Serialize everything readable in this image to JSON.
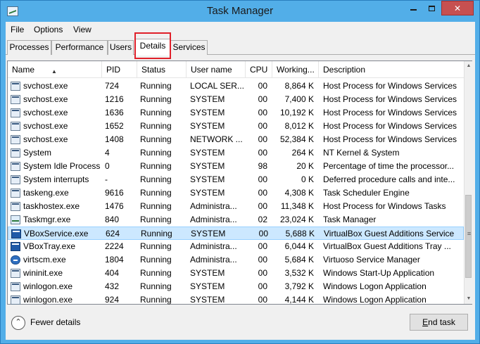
{
  "window": {
    "title": "Task Manager",
    "minimize": "",
    "maximize": "",
    "close": "✕"
  },
  "menu": [
    "File",
    "Options",
    "View"
  ],
  "tabs": [
    {
      "label": "Processes"
    },
    {
      "label": "Performance"
    },
    {
      "label": "Users"
    },
    {
      "label": "Details",
      "active": true
    },
    {
      "label": "Services"
    }
  ],
  "columns": {
    "name": "Name",
    "pid": "PID",
    "status": "Status",
    "user": "User name",
    "cpu": "CPU",
    "working": "Working...",
    "description": "Description"
  },
  "rows": [
    {
      "icon": "service-icon",
      "name": "svchost.exe",
      "pid": "724",
      "status": "Running",
      "user": "LOCAL SER...",
      "cpu": "00",
      "ws": "8,864 K",
      "desc": "Host Process for Windows Services"
    },
    {
      "icon": "service-icon",
      "name": "svchost.exe",
      "pid": "1216",
      "status": "Running",
      "user": "SYSTEM",
      "cpu": "00",
      "ws": "7,400 K",
      "desc": "Host Process for Windows Services"
    },
    {
      "icon": "service-icon",
      "name": "svchost.exe",
      "pid": "1636",
      "status": "Running",
      "user": "SYSTEM",
      "cpu": "00",
      "ws": "10,192 K",
      "desc": "Host Process for Windows Services"
    },
    {
      "icon": "service-icon",
      "name": "svchost.exe",
      "pid": "1652",
      "status": "Running",
      "user": "SYSTEM",
      "cpu": "00",
      "ws": "8,012 K",
      "desc": "Host Process for Windows Services"
    },
    {
      "icon": "service-icon",
      "name": "svchost.exe",
      "pid": "1408",
      "status": "Running",
      "user": "NETWORK ...",
      "cpu": "00",
      "ws": "52,384 K",
      "desc": "Host Process for Windows Services"
    },
    {
      "icon": "service-icon",
      "name": "System",
      "pid": "4",
      "status": "Running",
      "user": "SYSTEM",
      "cpu": "00",
      "ws": "264 K",
      "desc": "NT Kernel & System"
    },
    {
      "icon": "service-icon",
      "name": "System Idle Process",
      "pid": "0",
      "status": "Running",
      "user": "SYSTEM",
      "cpu": "98",
      "ws": "20 K",
      "desc": "Percentage of time the processor..."
    },
    {
      "icon": "service-icon",
      "name": "System interrupts",
      "pid": "-",
      "status": "Running",
      "user": "SYSTEM",
      "cpu": "00",
      "ws": "0 K",
      "desc": "Deferred procedure calls and inte..."
    },
    {
      "icon": "service-icon",
      "name": "taskeng.exe",
      "pid": "9616",
      "status": "Running",
      "user": "SYSTEM",
      "cpu": "00",
      "ws": "4,308 K",
      "desc": "Task Scheduler Engine"
    },
    {
      "icon": "service-icon",
      "name": "taskhostex.exe",
      "pid": "1476",
      "status": "Running",
      "user": "Administra...",
      "cpu": "00",
      "ws": "11,348 K",
      "desc": "Host Process for Windows Tasks"
    },
    {
      "icon": "task-manager-icon",
      "name": "Taskmgr.exe",
      "pid": "840",
      "status": "Running",
      "user": "Administra...",
      "cpu": "02",
      "ws": "23,024 K",
      "desc": "Task Manager"
    },
    {
      "icon": "virtualbox-icon",
      "name": "VBoxService.exe",
      "pid": "624",
      "status": "Running",
      "user": "SYSTEM",
      "cpu": "00",
      "ws": "5,688 K",
      "desc": "VirtualBox Guest Additions Service",
      "selected": true
    },
    {
      "icon": "virtualbox-icon",
      "name": "VBoxTray.exe",
      "pid": "2224",
      "status": "Running",
      "user": "Administra...",
      "cpu": "00",
      "ws": "6,044 K",
      "desc": "VirtualBox Guest Additions Tray ..."
    },
    {
      "icon": "virtuoso-icon",
      "name": "virtscm.exe",
      "pid": "1804",
      "status": "Running",
      "user": "Administra...",
      "cpu": "00",
      "ws": "5,684 K",
      "desc": "Virtuoso Service Manager"
    },
    {
      "icon": "service-icon",
      "name": "wininit.exe",
      "pid": "404",
      "status": "Running",
      "user": "SYSTEM",
      "cpu": "00",
      "ws": "3,532 K",
      "desc": "Windows Start-Up Application"
    },
    {
      "icon": "service-icon",
      "name": "winlogon.exe",
      "pid": "432",
      "status": "Running",
      "user": "SYSTEM",
      "cpu": "00",
      "ws": "3,792 K",
      "desc": "Windows Logon Application"
    },
    {
      "icon": "service-icon",
      "name": "winlogon.exe",
      "pid": "924",
      "status": "Running",
      "user": "SYSTEM",
      "cpu": "00",
      "ws": "4,144 K",
      "desc": "Windows Logon Application"
    }
  ],
  "footer": {
    "fewer_details": "Fewer details",
    "end_task_prefix": "E",
    "end_task_rest": "nd task"
  },
  "colors": {
    "selected_row": "#cce8ff",
    "close_button": "#c75050",
    "highlight": "#e0202a"
  }
}
